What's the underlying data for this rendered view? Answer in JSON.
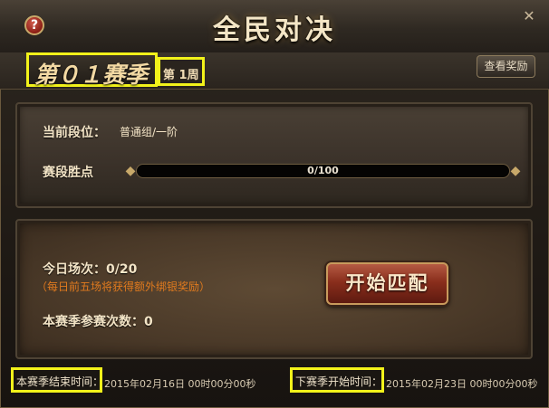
{
  "window": {
    "title": "全民对决",
    "help_symbol": "?",
    "close_symbol": "✕",
    "accent_color": "#f2f21a"
  },
  "season": {
    "label": "第０１赛季",
    "week": "第 1周",
    "reward_button": "查看奖励"
  },
  "rank_panel": {
    "tier_label": "当前段位：",
    "tier_value": "普通组/一阶",
    "points_label": "赛段胜点",
    "points_text": "0/100",
    "points_fraction": 0
  },
  "daily_panel": {
    "today_matches": "今日场次：0/20",
    "bonus_note": "（每日前五场将获得额外绑银奖励）",
    "season_matches": "本赛季参赛次数：0",
    "start_button": "开始匹配"
  },
  "footer": {
    "end_label": "本赛季结束时间：",
    "end_value": "2015年02月16日  00时00分00秒",
    "next_label": "下赛季开始时间：",
    "next_value": "2015年02月23日  00时00分00秒"
  },
  "icons": [
    "help-icon",
    "close-icon"
  ]
}
